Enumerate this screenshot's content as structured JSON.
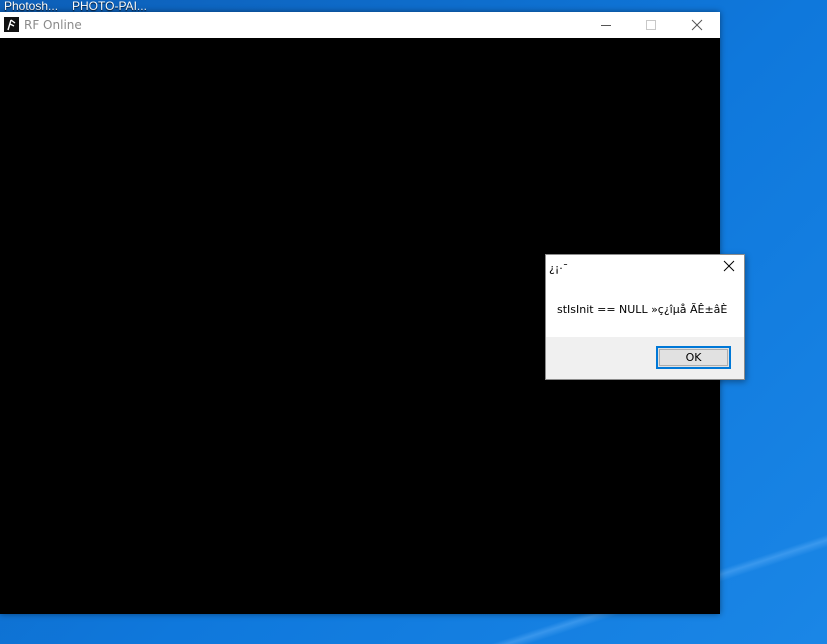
{
  "desktop": {
    "icons": [
      {
        "label": "Photosh..."
      },
      {
        "label": "PHOTO-PAI..."
      }
    ]
  },
  "window": {
    "title": "RF Online",
    "icon": "rf-online-app-icon",
    "controls": [
      "minimize-icon",
      "maximize-icon",
      "close-icon"
    ]
  },
  "dialog": {
    "title": "¿¡·¯",
    "message": "stIsInit == NULL »ç¿îµå ÃÊ±âÈ­",
    "ok_label": "OK"
  },
  "colors": {
    "desktop_blue": "#0f78dc",
    "accent_border": "#0078d7",
    "titlebar": "#ffffff",
    "client": "#000000"
  }
}
